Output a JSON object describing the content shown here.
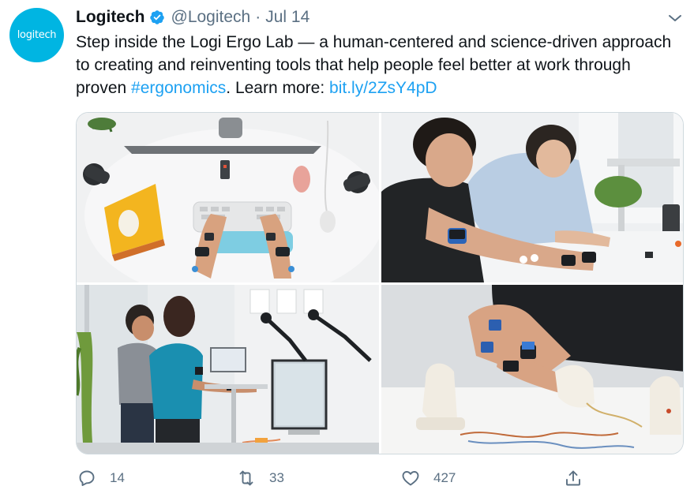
{
  "tweet": {
    "avatar_text": "logitech",
    "author_name": "Logitech",
    "handle": "@Logitech",
    "separator": "·",
    "date": "Jul 14",
    "text_main": "Step inside the Logi Ergo Lab — a human-centered and science-driven approach to creating and reinventing tools that help people feel better at work through proven ",
    "hashtag": "#ergonomics",
    "text_mid": ". Learn more: ",
    "link": "bit.ly/2ZsY4pD"
  },
  "media": {
    "images": [
      {
        "name": "ergonomic-keyboard-setup-photo"
      },
      {
        "name": "arm-sensor-testing-photo"
      },
      {
        "name": "lab-standing-desk-photo"
      },
      {
        "name": "vertical-mouse-sensor-photo"
      }
    ]
  },
  "actions": {
    "reply_count": "14",
    "retweet_count": "33",
    "like_count": "427"
  },
  "colors": {
    "brand": "#00b5e2",
    "link": "#1da1f2",
    "muted": "#5b7083"
  },
  "icons": [
    "verified-badge-icon",
    "chevron-down-icon",
    "reply-icon",
    "retweet-icon",
    "like-icon",
    "share-icon"
  ]
}
